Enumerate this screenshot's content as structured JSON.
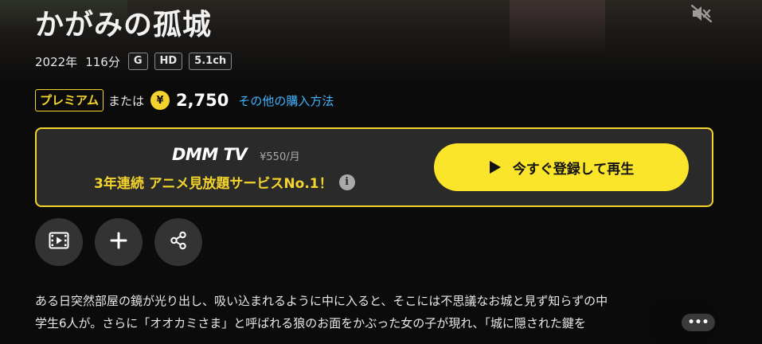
{
  "title": "かがみの孤城",
  "meta": {
    "year": "2022年",
    "duration": "116分",
    "badges": [
      "G",
      "HD",
      "5.1ch"
    ]
  },
  "pricing": {
    "premium_label": "プレミアム",
    "or_text": "または",
    "yen_symbol": "¥",
    "price": "2,750",
    "other_purchase_link": "その他の購入方法"
  },
  "promo": {
    "logo_text": "DMM TV",
    "monthly_price": "¥550/月",
    "slogan": "3年連続 アニメ見放題サービスNo.1！",
    "info_symbol": "i",
    "cta_label": "今すぐ登録して再生"
  },
  "actions": {
    "icons": [
      "trailer-icon",
      "add-icon",
      "share-icon"
    ]
  },
  "description": {
    "line1": "ある日突然部屋の鏡が光り出し、吸い込まれるように中に入ると、そこには不思議なお城と見ず知らずの中",
    "line2": "学生6人が。さらに「オオカミさま」と呼ばれる狼のお面をかぶった女の子が現れ、「城に隠された鍵を",
    "more_label": "•••"
  },
  "colors": {
    "accent_yellow": "#f3d32c",
    "cta_yellow": "#fbe52a",
    "link_blue": "#41b3ff",
    "background": "#0b0b0b",
    "panel": "#2a2a2a"
  }
}
